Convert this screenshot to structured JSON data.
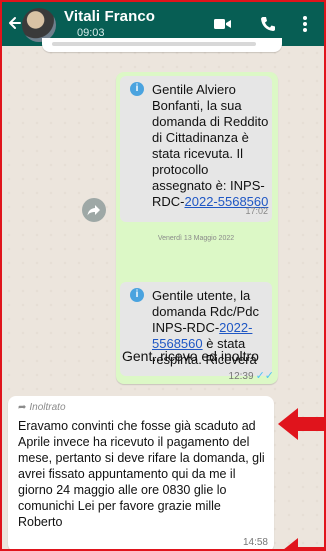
{
  "header": {
    "contact_name": "Vitali Franco",
    "subtitle": "09:03"
  },
  "sent_message": {
    "card1": {
      "text_before_link": "Gentile Alviero Bonfanti, la sua domanda di Reddito di Cittadinanza è stata ricevuta. Il protocollo assegnato è: INPS-RDC-",
      "link": "2022-5568560",
      "time": "17:02"
    },
    "date_separator": "Venerdì 13 Maggio 2022",
    "card2": {
      "text_before_link": "Gentile utente, la domanda Rdc/Pdc INPS-RDC-",
      "link": "2022-5568560",
      "text_after_link": " è stata respinta. Riceverà"
    },
    "caption": "Gent..ricevo ed inoltro",
    "time": "12:39",
    "ticks": "✓✓"
  },
  "received_message": {
    "forwarded_label": "Inoltrato",
    "text": "Eravamo convinti che fosse già scaduto ad Aprile invece ha ricevuto il pagamento del mese, pertanto si deve rifare la domanda, gli avrei fissato appuntamento qui da me il giorno 24 maggio alle ore 0830 glie lo comunichi Lei per favore grazie mille Roberto",
    "time": "14:58"
  },
  "icons": {
    "back": "back-arrow-icon",
    "video": "video-call-icon",
    "call": "phone-icon",
    "menu": "more-vert-icon",
    "info": "info-icon",
    "forward": "forward-icon",
    "annotation": "red-arrow-icon"
  },
  "colors": {
    "header_bg": "#075e54",
    "chat_bg": "#ece5dd",
    "sent_bubble": "#dcf8c6",
    "received_bubble": "#ffffff",
    "link": "#1f57c4",
    "annotation": "#e0141c",
    "read_ticks": "#4fc3f7"
  }
}
